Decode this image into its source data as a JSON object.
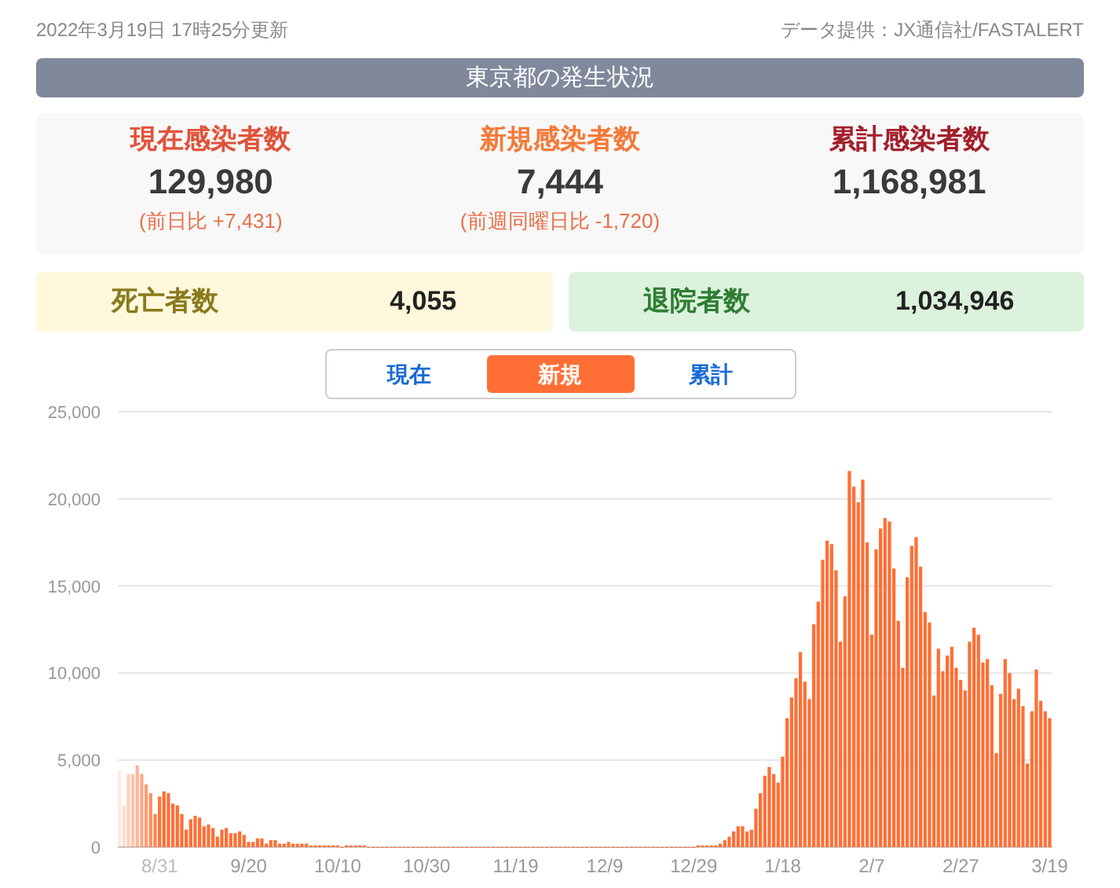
{
  "updated": "2022年3月19日 17時25分更新",
  "source": "データ提供：JX通信社/FASTALERT",
  "title": "東京都の発生状況",
  "stats": [
    {
      "kind": "current",
      "label": "現在感染者数",
      "value": "129,980",
      "note": "(前日比 +7,431)"
    },
    {
      "kind": "new",
      "label": "新規感染者数",
      "value": "7,444",
      "note": "(前週同曜日比 -1,720)"
    },
    {
      "kind": "total",
      "label": "累計感染者数",
      "value": "1,168,981"
    }
  ],
  "summary": [
    {
      "kind": "deaths",
      "label": "死亡者数",
      "value": "4,055"
    },
    {
      "kind": "discharged",
      "label": "退院者数",
      "value": "1,034,946"
    }
  ],
  "tabs": [
    {
      "label": "現在",
      "selected": false
    },
    {
      "label": "新規",
      "selected": true
    },
    {
      "label": "累計",
      "selected": false
    }
  ],
  "chart_data": {
    "type": "bar",
    "grid": true,
    "categories": [
      null,
      null,
      null,
      null,
      null,
      null,
      null,
      null,
      null,
      "8/31",
      null,
      null,
      null,
      null,
      null,
      null,
      null,
      null,
      null,
      null,
      null,
      null,
      null,
      null,
      null,
      null,
      null,
      null,
      null,
      "9/20",
      null,
      null,
      null,
      null,
      null,
      null,
      null,
      null,
      null,
      null,
      null,
      null,
      null,
      null,
      null,
      null,
      null,
      null,
      null,
      "10/10",
      null,
      null,
      null,
      null,
      null,
      null,
      null,
      null,
      null,
      null,
      null,
      null,
      null,
      null,
      null,
      null,
      null,
      null,
      null,
      "10/30",
      null,
      null,
      null,
      null,
      null,
      null,
      null,
      null,
      null,
      null,
      null,
      null,
      null,
      null,
      null,
      null,
      null,
      null,
      null,
      "11/19",
      null,
      null,
      null,
      null,
      null,
      null,
      null,
      null,
      null,
      null,
      null,
      null,
      null,
      null,
      null,
      null,
      null,
      null,
      null,
      "12/9",
      null,
      null,
      null,
      null,
      null,
      null,
      null,
      null,
      null,
      null,
      null,
      null,
      null,
      null,
      null,
      null,
      null,
      null,
      null,
      "12/29",
      null,
      null,
      null,
      null,
      null,
      null,
      null,
      null,
      null,
      null,
      null,
      null,
      null,
      null,
      null,
      null,
      null,
      null,
      null,
      "1/18",
      null,
      null,
      null,
      null,
      null,
      null,
      null,
      null,
      null,
      null,
      null,
      null,
      null,
      null,
      null,
      null,
      null,
      null,
      null,
      "2/7",
      null,
      null,
      null,
      null,
      null,
      null,
      null,
      null,
      null,
      null,
      null,
      null,
      null,
      null,
      null,
      null,
      null,
      null,
      null,
      "2/27",
      null,
      null,
      null,
      null,
      null,
      null,
      null,
      null,
      null,
      null,
      null,
      null,
      null,
      null,
      null,
      null,
      null,
      null,
      null,
      "3/19"
    ],
    "series": [
      {
        "color": "#ff6f35",
        "values": [
          4400,
          2400,
          4200,
          4200,
          4700,
          4200,
          3600,
          3100,
          1900,
          2900,
          3200,
          3100,
          2500,
          2400,
          1900,
          1000,
          1600,
          1800,
          1700,
          1200,
          1300,
          1100,
          600,
          1000,
          1100,
          800,
          800,
          900,
          700,
          300,
          300,
          500,
          500,
          200,
          400,
          400,
          200,
          200,
          300,
          200,
          200,
          200,
          200,
          100,
          100,
          100,
          100,
          100,
          100,
          100,
          0,
          100,
          100,
          100,
          100,
          100,
          0,
          0,
          0,
          0,
          0,
          0,
          0,
          0,
          0,
          0,
          0,
          0,
          0,
          0,
          0,
          0,
          0,
          0,
          0,
          0,
          0,
          0,
          0,
          0,
          0,
          0,
          0,
          0,
          0,
          0,
          0,
          0,
          0,
          0,
          0,
          0,
          0,
          0,
          0,
          0,
          0,
          0,
          0,
          0,
          0,
          0,
          0,
          0,
          0,
          0,
          0,
          0,
          0,
          0,
          0,
          0,
          0,
          0,
          0,
          0,
          0,
          0,
          0,
          0,
          0,
          0,
          0,
          0,
          0,
          0,
          0,
          0,
          0,
          0,
          100,
          100,
          100,
          100,
          100,
          200,
          400,
          600,
          900,
          1200,
          1200,
          900,
          1000,
          2200,
          3100,
          4100,
          4600,
          4200,
          3700,
          5200,
          7400,
          8600,
          9700,
          11200,
          9500,
          8500,
          12800,
          14100,
          16500,
          17600,
          17400,
          15900,
          11800,
          14400,
          21600,
          20700,
          19800,
          21100,
          17500,
          12200,
          17100,
          18300,
          18900,
          18700,
          16000,
          13000,
          10300,
          15500,
          17300,
          17800,
          16100,
          13500,
          12900,
          8700,
          11400,
          10100,
          11000,
          11500,
          10300,
          9600,
          9000,
          11800,
          12600,
          12200,
          10600,
          10800,
          9300,
          5400,
          8800,
          10800,
          10000,
          8500,
          9100,
          8100,
          4800,
          7800,
          10200,
          8400,
          7800,
          7400
        ]
      }
    ],
    "ylim": [
      0,
      25000
    ],
    "yticks": [
      {
        "value": 0,
        "label": "0"
      },
      {
        "value": 5000,
        "label": "5,000"
      },
      {
        "value": 10000,
        "label": "10,000"
      },
      {
        "value": 15000,
        "label": "15,000"
      },
      {
        "value": 20000,
        "label": "20,000"
      },
      {
        "value": 25000,
        "label": "25,000"
      }
    ]
  }
}
